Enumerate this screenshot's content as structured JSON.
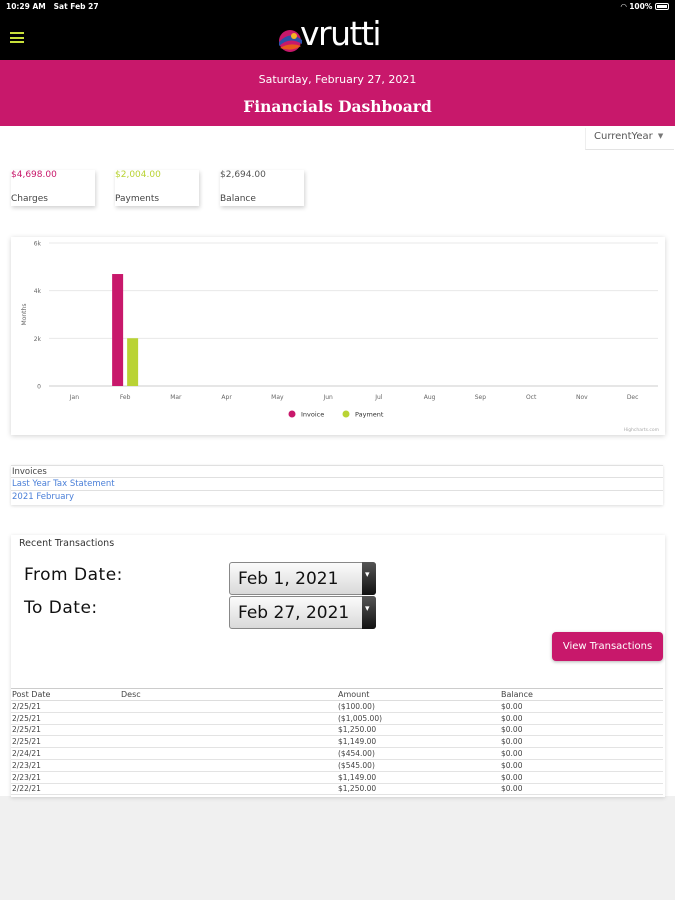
{
  "status_bar": {
    "time": "10:29 AM",
    "date": "Sat Feb 27",
    "battery": "100%"
  },
  "app": {
    "logo_text": "vrutti"
  },
  "banner": {
    "date": "Saturday, February 27, 2021",
    "title": "Financials Dashboard"
  },
  "period_select": {
    "value": "CurrentYear"
  },
  "summary_cards": [
    {
      "value": "$4,698.00",
      "label": "Charges",
      "color": "#c8186b"
    },
    {
      "value": "$2,004.00",
      "label": "Payments",
      "color": "#b9d334"
    },
    {
      "value": "$2,694.00",
      "label": "Balance",
      "color": "#555555"
    }
  ],
  "chart_data": {
    "type": "bar",
    "categories": [
      "Jan",
      "Feb",
      "Mar",
      "Apr",
      "May",
      "Jun",
      "Jul",
      "Aug",
      "Sep",
      "Oct",
      "Nov",
      "Dec"
    ],
    "series": [
      {
        "name": "Invoice",
        "color": "#c8186b",
        "values": [
          0,
          4698,
          0,
          0,
          0,
          0,
          0,
          0,
          0,
          0,
          0,
          0
        ]
      },
      {
        "name": "Payment",
        "color": "#b9d334",
        "values": [
          0,
          2004,
          0,
          0,
          0,
          0,
          0,
          0,
          0,
          0,
          0,
          0
        ]
      }
    ],
    "ylabel": "Months",
    "ylim": [
      0,
      6000
    ],
    "yticks": [
      0,
      2000,
      4000,
      6000
    ],
    "ytick_labels": [
      "0",
      "2k",
      "4k",
      "6k"
    ],
    "legend": "bottom",
    "credits": "Highcharts.com"
  },
  "invoices": {
    "header": "Invoices",
    "links": [
      "Last Year Tax Statement",
      "2021 February"
    ]
  },
  "transactions": {
    "title": "Recent Transactions",
    "from_label": "From Date:",
    "from_value": "Feb 1, 2021",
    "to_label": "To Date:",
    "to_value": "Feb 27, 2021",
    "view_button": "View Transactions",
    "columns": [
      "Post Date",
      "Desc",
      "Amount",
      "Balance"
    ],
    "rows": [
      [
        "2/25/21",
        "",
        "($100.00)",
        "$0.00"
      ],
      [
        "2/25/21",
        "",
        "($1,005.00)",
        "$0.00"
      ],
      [
        "2/25/21",
        "",
        "$1,250.00",
        "$0.00"
      ],
      [
        "2/25/21",
        "",
        "$1,149.00",
        "$0.00"
      ],
      [
        "2/24/21",
        "",
        "($454.00)",
        "$0.00"
      ],
      [
        "2/23/21",
        "",
        "($545.00)",
        "$0.00"
      ],
      [
        "2/23/21",
        "",
        "$1,149.00",
        "$0.00"
      ],
      [
        "2/22/21",
        "",
        "$1,250.00",
        "$0.00"
      ]
    ]
  }
}
